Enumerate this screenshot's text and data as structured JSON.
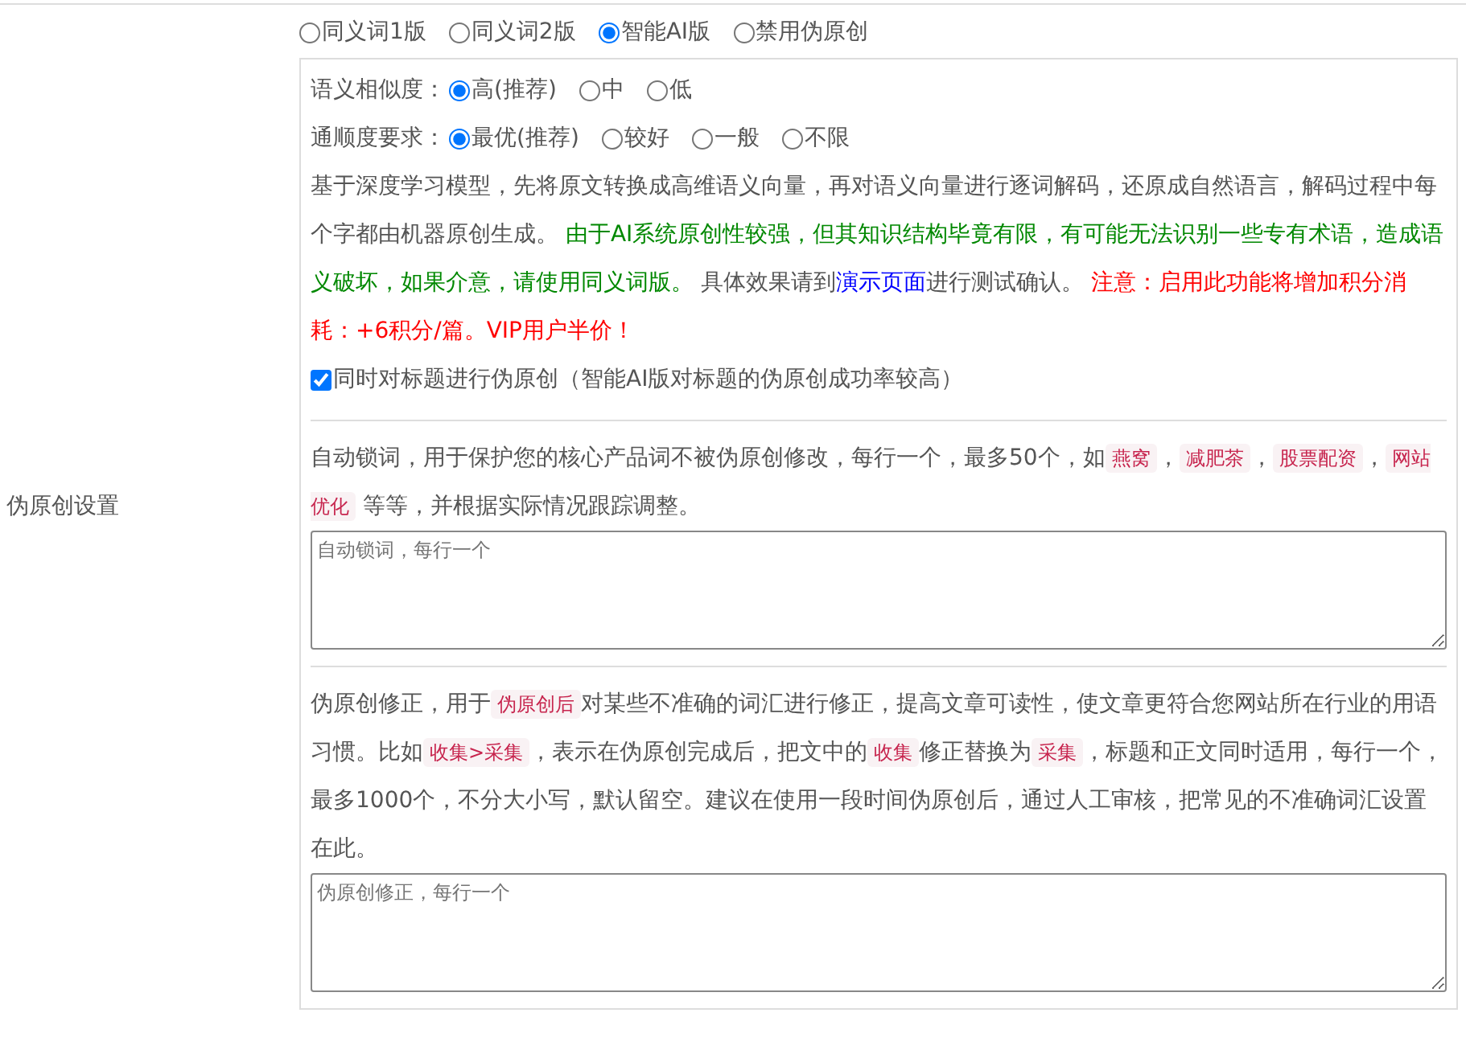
{
  "form_label": "伪原创设置",
  "modes": [
    {
      "label": "同义词1版",
      "selected": false
    },
    {
      "label": "同义词2版",
      "selected": false
    },
    {
      "label": "智能AI版",
      "selected": true
    },
    {
      "label": "禁用伪原创",
      "selected": false
    }
  ],
  "similarity": {
    "label": "语义相似度：",
    "options": [
      {
        "label": "高(推荐)",
        "selected": true
      },
      {
        "label": "中",
        "selected": false
      },
      {
        "label": "低",
        "selected": false
      }
    ]
  },
  "fluency": {
    "label": "通顺度要求：",
    "options": [
      {
        "label": "最优(推荐)",
        "selected": true
      },
      {
        "label": "较好",
        "selected": false
      },
      {
        "label": "一般",
        "selected": false
      },
      {
        "label": "不限",
        "selected": false
      }
    ]
  },
  "ai_description": [
    {
      "kind": "text",
      "text": "基于深度学习模型，先将原文转换成高维语义向量，再对语义向量进行逐词解码，还原成自然语言，解码过程中每个字都由机器原创生成。 "
    },
    {
      "kind": "notice",
      "text": "由于AI系统原创性较强，但其知识结构毕竟有限，有可能无法识别一些专有术语，造成语义破坏，如果介意，请使用同义词版。"
    },
    {
      "kind": "text",
      "text": " 具体效果请到"
    },
    {
      "kind": "link",
      "text": "演示页面"
    },
    {
      "kind": "text",
      "text": "进行测试确认。 "
    },
    {
      "kind": "warning",
      "text": "注意：启用此功能将增加积分消耗：+6积分/篇。VIP用户半价！"
    }
  ],
  "title_option": {
    "label": "同时对标题进行伪原创（智能AI版对标题的伪原创成功率较高）",
    "checked": true
  },
  "lock_words": {
    "description": [
      {
        "kind": "text",
        "text": "自动锁词，用于保护您的核心产品词不被伪原创修改，每行一个，最多50个，如"
      },
      {
        "kind": "tag",
        "text": "燕窝"
      },
      {
        "kind": "text",
        "text": "，"
      },
      {
        "kind": "tag",
        "text": "减肥茶"
      },
      {
        "kind": "text",
        "text": "，"
      },
      {
        "kind": "tag",
        "text": "股票配资"
      },
      {
        "kind": "text",
        "text": "，"
      },
      {
        "kind": "tag",
        "text": "网站优化"
      },
      {
        "kind": "text",
        "text": " 等等，并根据实际情况跟踪调整。"
      }
    ],
    "placeholder": "自动锁词，每行一个"
  },
  "corrections": {
    "description": [
      {
        "kind": "text",
        "text": "伪原创修正，用于"
      },
      {
        "kind": "tag",
        "text": "伪原创后"
      },
      {
        "kind": "text",
        "text": "对某些不准确的词汇进行修正，提高文章可读性，使文章更符合您网站所在行业的用语习惯。比如"
      },
      {
        "kind": "tag",
        "text": "收集>采集"
      },
      {
        "kind": "text",
        "text": "，表示在伪原创完成后，把文中的"
      },
      {
        "kind": "tag",
        "text": "收集"
      },
      {
        "kind": "text",
        "text": "修正替换为"
      },
      {
        "kind": "tag",
        "text": "采集"
      },
      {
        "kind": "text",
        "text": "，标题和正文同时适用，每行一个，最多1000个，不分大小写，默认留空。建议在使用一段时间伪原创后，通过人工审核，把常见的不准确词汇设置在此。"
      }
    ],
    "placeholder": "伪原创修正，每行一个"
  }
}
